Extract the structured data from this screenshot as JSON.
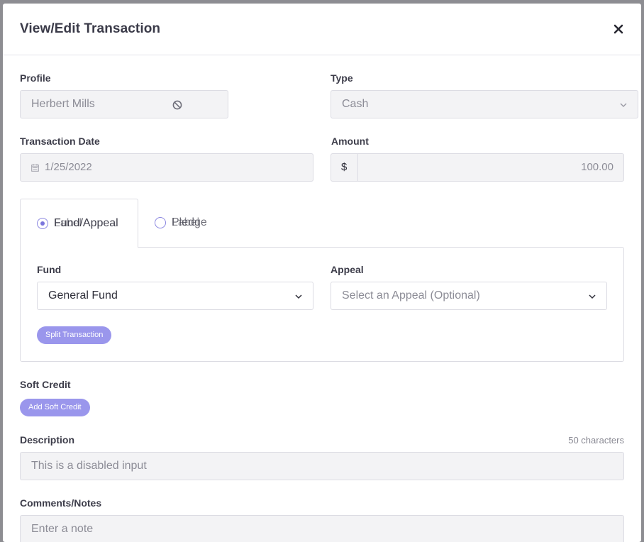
{
  "modal": {
    "title": "View/Edit Transaction",
    "close_icon": "close-icon"
  },
  "profile": {
    "label": "Profile",
    "value": "Herbert Mills",
    "status_icon": "disabled-icon"
  },
  "type": {
    "label": "Type",
    "value": "Cash"
  },
  "transaction_date": {
    "label": "Transaction Date",
    "value": "1/25/2022",
    "icon": "calendar-icon"
  },
  "amount": {
    "label": "Amount",
    "currency": "$",
    "value": "100.00"
  },
  "tabs": {
    "fund_appeal": {
      "label": "Fund/Appeal",
      "overlap": "Label",
      "selected": true
    },
    "pledge": {
      "label": "Pledge",
      "overlap": "Label",
      "selected": false
    }
  },
  "fund": {
    "label": "Fund",
    "value": "General Fund"
  },
  "appeal": {
    "label": "Appeal",
    "placeholder": "Select an Appeal (Optional)"
  },
  "split_button": "Split Transaction",
  "soft_credit": {
    "label": "Soft Credit",
    "button": "Add Soft Credit"
  },
  "description": {
    "label": "Description",
    "counter": "50 characters",
    "placeholder": "This is a disabled input"
  },
  "comments": {
    "label": "Comments/Notes",
    "placeholder": "Enter a note"
  },
  "colors": {
    "accent": "#9a96ec",
    "radio": "#7b76dc",
    "disabled_bg": "#f3f3f5",
    "border": "#dcdce3"
  }
}
